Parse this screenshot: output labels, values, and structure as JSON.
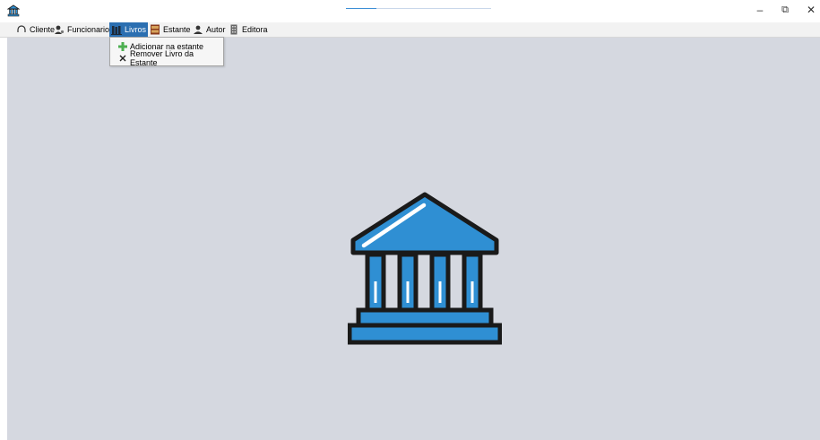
{
  "window": {
    "controls": {
      "minimize": "–",
      "restore": "⧉",
      "close": "✕"
    },
    "icon": "bank-icon"
  },
  "menubar": {
    "items": [
      {
        "label": "Cliente",
        "icon": "headphones-icon"
      },
      {
        "label": "Funcionario",
        "icon": "users-icon"
      },
      {
        "label": "Livros",
        "icon": "books-icon",
        "active": true
      },
      {
        "label": "Estante",
        "icon": "bookshelf-icon"
      },
      {
        "label": "Autor",
        "icon": "author-icon"
      },
      {
        "label": "Editora",
        "icon": "building-icon"
      }
    ]
  },
  "dropdown": {
    "items": [
      {
        "label": "Adicionar na estante",
        "icon": "plus-icon"
      },
      {
        "label": "Remover Livro da Estante",
        "icon": "close-icon"
      }
    ]
  },
  "colors": {
    "desktop": "#d5d8e0",
    "logo_blue": "#2f8fd3",
    "menu_active": "#2b6fb1"
  }
}
